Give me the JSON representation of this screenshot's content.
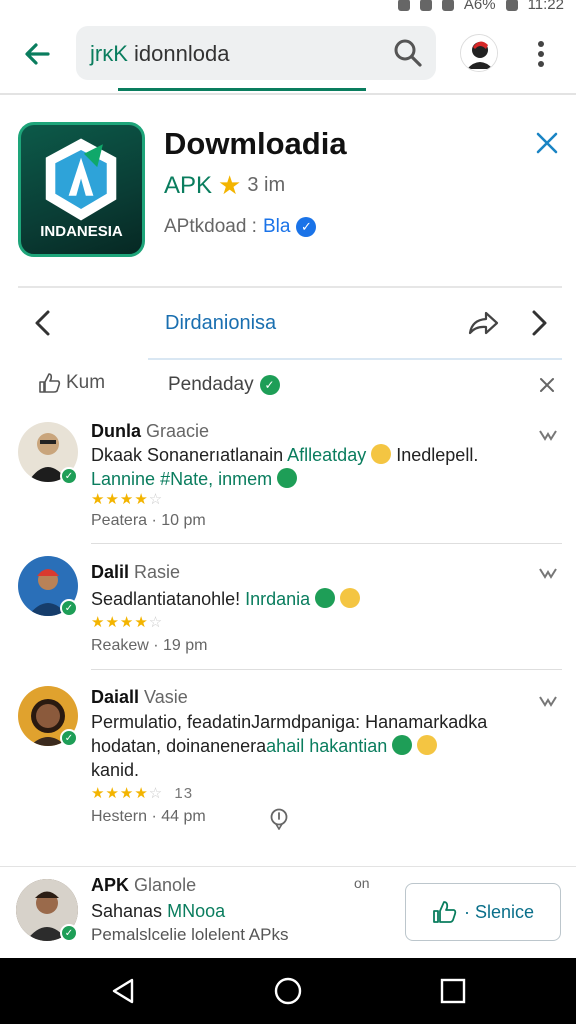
{
  "status_bar": {
    "battery": "A6%",
    "time": "11:22"
  },
  "search": {
    "query_prefix": "jrκK",
    "query_rest": " idonnloda"
  },
  "app": {
    "title": "Dowmloadia",
    "subtitle": "APK",
    "meta": "3 im",
    "dev_label": "APtkdoad :",
    "dev_name": "Bla",
    "icon_label": "INDANESIA"
  },
  "tab": {
    "label": "Dirdanionisa"
  },
  "filter": {
    "like_label": "Kum",
    "sort_label": "Pendaday"
  },
  "reviews": [
    {
      "name": "Dunla",
      "name_sub": "Graacie",
      "body_start": "Dkaak Sonanerıatlanain",
      "body_green": "Aflleatday",
      "body_end": "Inedlepell.",
      "body_line2_green": "Lannine #Nate, inmem",
      "stars": "★★★★",
      "stars_off": "☆",
      "meta": "Peatera · 10 pm"
    },
    {
      "name": "Dalil",
      "name_sub": "Rasie",
      "body_start": "Seadlantiatanohle!",
      "body_green": "Inrdania",
      "stars": "★★★★",
      "stars_off": "☆",
      "meta": "Reakew · 19 pm"
    },
    {
      "name": "Daiall",
      "name_sub": "Vasie",
      "body_start": "Permulatio, feadatinJarmdpaniga: Hanamarkadka",
      "body_mid": "hodatan, doinanenera",
      "body_green": "ahail hakantian",
      "body_line3": "kanid.",
      "stars": "★★★★",
      "stars_off": "☆",
      "count": "13",
      "meta": "Hestern · 44 pm"
    }
  ],
  "bottom": {
    "name": "APK",
    "name_sub": "Glanole",
    "time": "on",
    "line1_start": "Sahanas",
    "line1_green": "MNooa",
    "line2": "Pemalslcelie lolelent APks",
    "button_label": "· Slenice"
  }
}
